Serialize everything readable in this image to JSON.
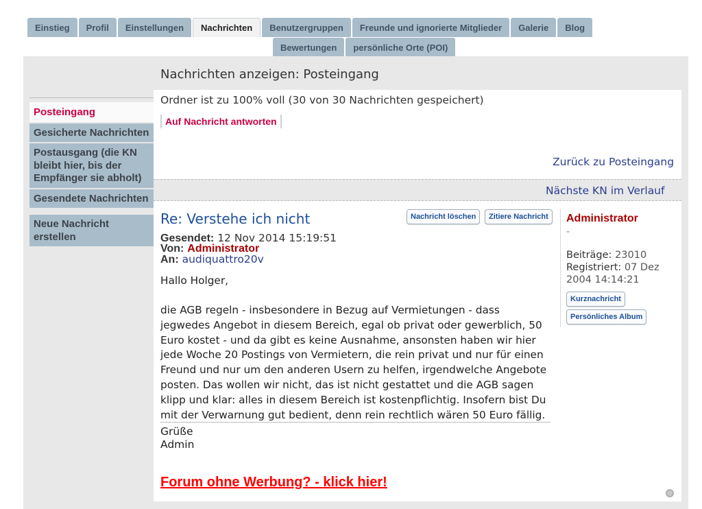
{
  "tabs": {
    "row1": [
      "Einstieg",
      "Profil",
      "Einstellungen",
      "Nachrichten",
      "Benutzergruppen",
      "Freunde und ignorierte Mitglieder",
      "Galerie",
      "Blog"
    ],
    "row2": [
      "Bewertungen",
      "persönliche Orte (POI)"
    ]
  },
  "page_title": "Nachrichten anzeigen: Posteingang",
  "sidebar": {
    "items": [
      {
        "label": "Posteingang"
      },
      {
        "label": "Gesicherte Nachrichten"
      },
      {
        "label": "Postausgang (die KN bleibt hier, bis der Empfänger sie abholt)"
      },
      {
        "label": "Gesendete Nachrichten"
      }
    ],
    "new_message": "Neue Nachricht erstellen"
  },
  "folder_status": "Ordner ist zu 100% voll (30 von 30 Nachrichten gespeichert)",
  "reply_button": "Auf Nachricht antworten",
  "back_link": "Zurück zu Posteingang",
  "next_link": "Nächste KN im Verlauf",
  "message": {
    "subject": "Re: Verstehe ich nicht",
    "delete_button": "Nachricht löschen",
    "quote_button": "Zitiere Nachricht",
    "sent_label": "Gesendet:",
    "sent_value": "12 Nov 2014 15:19:51",
    "from_label": "Von:",
    "from_value": "Administrator",
    "to_label": "An:",
    "to_value": "audiquattro20v",
    "greeting": "Hallo Holger,",
    "body": "die AGB regeln - insbesondere in Bezug auf Vermietungen - dass jegwedes Angebot in diesem Bereich, egal ob privat oder gewerblich, 50 Euro kostet - und da gibt es keine Ausnahme, ansonsten haben wir hier jede Woche 20 Postings von Vermietern, die rein privat und nur für einen Freund und nur um den anderen Usern zu helfen, irgendwelche Angebote posten. Das wollen wir nicht, das ist nicht gestattet und die AGB sagen klipp und klar: alles in diesem Bereich ist kostenpflichtig. Insofern bist Du mit der Verwarnung gut bedient, denn rein rechtlich wären 50 Euro fällig.",
    "signature_line1": "Grüße",
    "signature_line2": "Admin",
    "promo_link": "Forum ohne Werbung? - klick hier!"
  },
  "author": {
    "name": "Administrator",
    "rank": "-",
    "posts_label": "Beiträge:",
    "posts_value": "23010",
    "registered_label": "Registriert:",
    "registered_value": "07 Dez 2004 14:14:21",
    "pm_button": "Kurznachricht",
    "album_button": "Persönliches Album"
  },
  "colors": {
    "tab_bg": "#a9bcca",
    "active_sidebar_text": "#cc0044",
    "link_blue": "#2a3d8f",
    "admin_red": "#aa0000",
    "promo_red": "#ff0000"
  }
}
